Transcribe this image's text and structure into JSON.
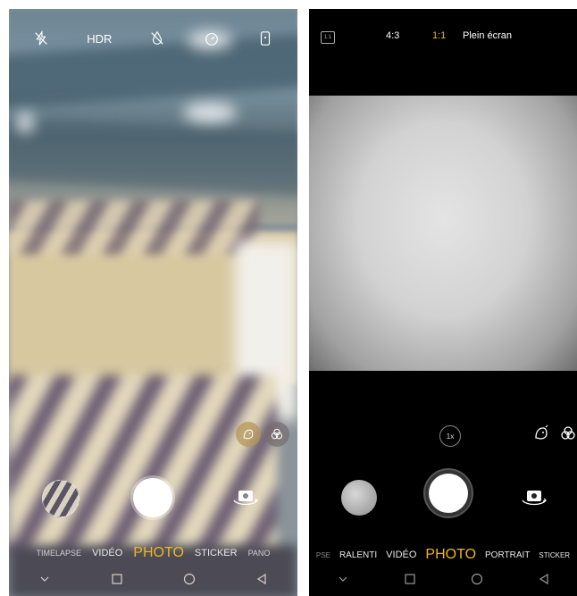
{
  "left_screen": {
    "top_bar": {
      "flash_icon": "flash-off-icon",
      "hdr_label": "HDR",
      "beauty_icon": "drop-off-icon",
      "timer_icon": "timer-icon",
      "settings_icon": "phone-settings-icon"
    },
    "filter_buttons": [
      "beauty-face-icon",
      "color-filter-icon"
    ],
    "modes": [
      "TIMELAPSE",
      "VIDÉO",
      "PHOTO",
      "STICKER",
      "PANO"
    ],
    "active_mode": "PHOTO",
    "accent_color": "#f0b51e"
  },
  "right_screen": {
    "top_bar": {
      "ratio_icon_label": "1:1",
      "ratio_4_3": "4:3",
      "ratio_1_1": "1:1",
      "ratio_full": "Plein écran"
    },
    "zoom_label": "1x",
    "modes": [
      "PSE",
      "RALENTI",
      "VIDÉO",
      "PHOTO",
      "PORTRAIT",
      "STICKER"
    ],
    "active_mode": "PHOTO",
    "accent_color": "#f0b51e"
  },
  "navigation": [
    "back-icon",
    "recents-icon",
    "home-icon",
    "back-triangle-icon"
  ]
}
